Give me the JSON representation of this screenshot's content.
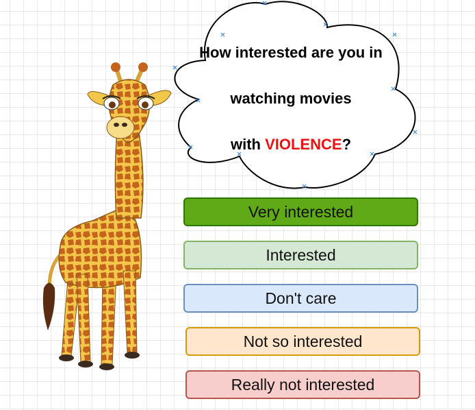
{
  "question": {
    "line1": "How interested are you in",
    "line2": "watching movies",
    "line3_prefix": "with ",
    "line3_highlight": "VIOLENCE",
    "line3_suffix": "?",
    "highlight_color": "#ee1111"
  },
  "options": [
    {
      "label": "Very interested",
      "fill": "#60a917",
      "stroke": "#2d7600"
    },
    {
      "label": "Interested",
      "fill": "#d5e8d4",
      "stroke": "#82b366"
    },
    {
      "label": "Don't care",
      "fill": "#dae8fc",
      "stroke": "#6c8ebf"
    },
    {
      "label": "Not so interested",
      "fill": "#ffe6cc",
      "stroke": "#d79b00"
    },
    {
      "label": "Really not interested",
      "fill": "#f8cecc",
      "stroke": "#b85450"
    }
  ],
  "illustration": "giraffe",
  "bubble_shape": "cloud"
}
